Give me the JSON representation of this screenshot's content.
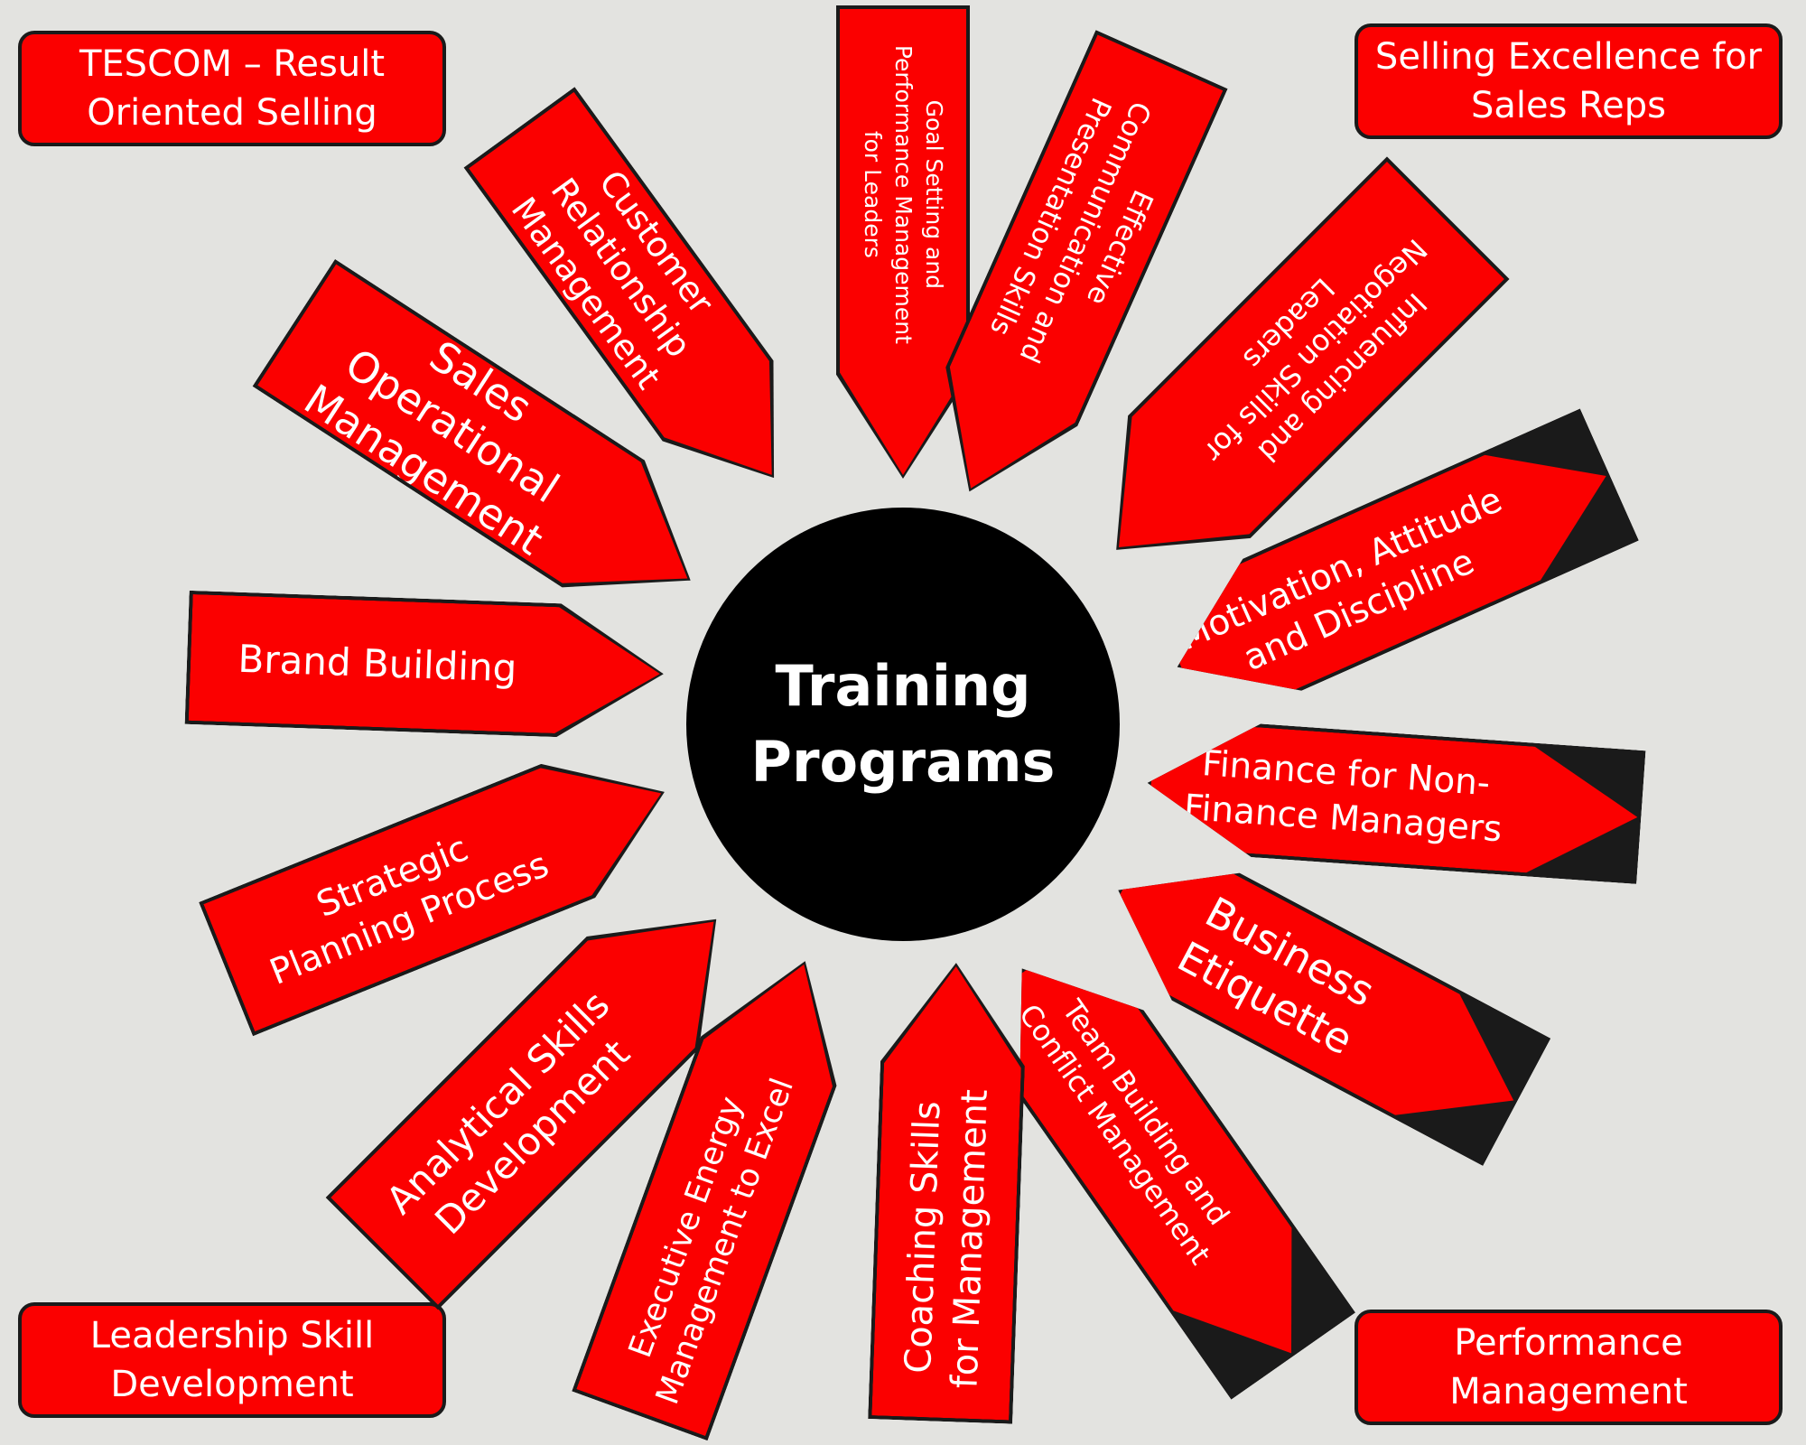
{
  "hub": {
    "title": "Training\nPrograms"
  },
  "corners": {
    "top_left": "TESCOM – Result\nOriented Selling",
    "top_right": "Selling Excellence for\nSales Reps",
    "bottom_left": "Leadership Skill\nDevelopment",
    "bottom_right": "Performance\nManagement"
  },
  "programs": [
    "Customer Relationship\nManagement",
    "Goal Setting and\nPerformance Management\nfor Leaders",
    "Effective\nCommunication and\nPresentation Skills",
    "Influencing and\nNegotiation Skills for\nLeaders",
    "Motivation, Attitude\nand Discipline",
    "Finance for Non-\nFinance Managers",
    "Business\nEtiquette",
    "Team Building and\nConflict Management",
    "Coaching Skills\nfor Management",
    "Executive Energy\nManagement to Excel",
    "Analytical Skills\nDevelopment",
    "Strategic\nPlanning Process",
    "Brand Building",
    "Sales Operational\nManagement"
  ],
  "colors": {
    "box_fill": "#fb0000",
    "outline": "#1a1a1a",
    "hub_fill": "#000000",
    "background": "#e3e3e0",
    "text": "#ffffff"
  }
}
